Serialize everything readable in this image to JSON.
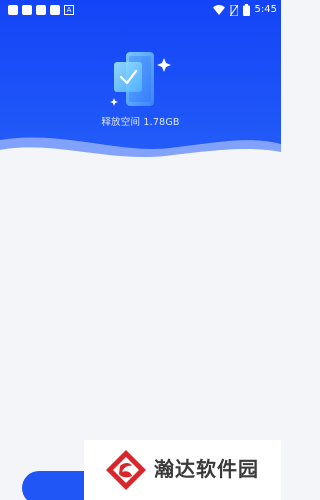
{
  "status_bar": {
    "time": "5:45",
    "left_icons": [
      "notification-square-icon",
      "notification-square-icon",
      "notification-square-icon",
      "notification-square-icon",
      "font-a-icon"
    ],
    "right_icons": [
      "wifi-icon",
      "no-sim-icon",
      "battery-icon"
    ],
    "a_glyph": "A"
  },
  "hero": {
    "release_label": "释放空间 1.78GB",
    "icon": "phone-check-icon"
  },
  "watermark": {
    "text": "瀚达软件园",
    "icon": "brand-logo-icon"
  },
  "colors": {
    "primary": "#1a4ef7",
    "background": "#f4f5f8",
    "text_light": "#dce6ff",
    "logo_red": "#d9262b"
  }
}
